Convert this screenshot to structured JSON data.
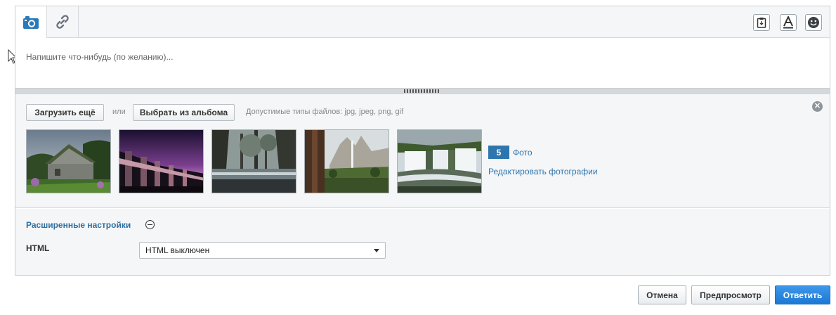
{
  "toolbar": {
    "photo_icon": "camera-icon",
    "link_icon": "link-icon",
    "right_icons": [
      "clipboard-icon",
      "font-icon",
      "smiley-icon"
    ]
  },
  "composer": {
    "placeholder": "Напишите что-нибудь (по желанию)..."
  },
  "upload": {
    "upload_more_label": "Загрузить ещё",
    "or_label": "или",
    "choose_album_label": "Выбрать из альбома",
    "allowed_types": "Допустимые типы файлов: jpg, jpeg, png, gif",
    "close_icon": "close-icon",
    "photos": [
      "cabin-photo",
      "castle-night-photo",
      "forest-lake-photo",
      "waterfall-cliff-photo",
      "waterfalls-photo"
    ],
    "photo_count": "5",
    "photo_count_label": "Фото",
    "edit_photos_label": "Редактировать фотографии"
  },
  "advanced": {
    "title": "Расширенные настройки",
    "html_label": "HTML",
    "html_select_value": "HTML выключен"
  },
  "footer": {
    "cancel_label": "Отмена",
    "preview_label": "Предпросмотр",
    "reply_label": "Ответить"
  },
  "colors": {
    "accent": "#2f75ad",
    "primary_button": "#1c79d4",
    "panel_bg": "#f4f6f8"
  }
}
